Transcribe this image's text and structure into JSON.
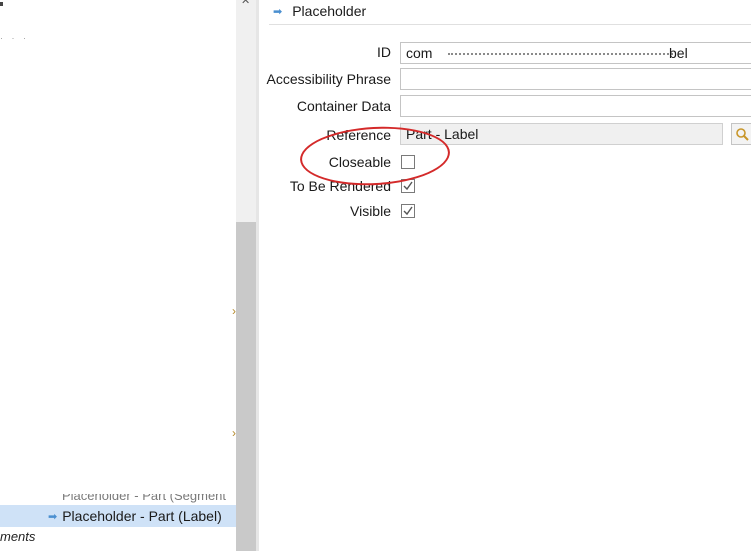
{
  "tree": {
    "partial_row": "Placeholder - Part (Segment",
    "partial_row_bracket": "t",
    "selected_row": "Placeholder - Part (Label)",
    "bottom_row": "ments"
  },
  "properties": {
    "section_title": "Placeholder",
    "fields": {
      "id": {
        "label": "ID",
        "value_start": "com",
        "value_end": "bel"
      },
      "accessibility": {
        "label": "Accessibility Phrase",
        "value": ""
      },
      "container_data": {
        "label": "Container Data",
        "value": ""
      },
      "reference": {
        "label": "Reference",
        "value": "Part - Label"
      }
    },
    "checkboxes": {
      "closeable": {
        "label": "Closeable",
        "checked": false
      },
      "to_be_rendered": {
        "label": "To Be Rendered",
        "checked": true
      },
      "visible": {
        "label": "Visible",
        "checked": true
      }
    }
  },
  "icons": {
    "section_arrow": "arrow-right-icon",
    "tree_arrow": "arrow-right-icon",
    "reference_search": "search-icon"
  },
  "colors": {
    "selection": "#cfe2f7",
    "annotation": "#d42a2a",
    "arrow": "#4a8fd0"
  }
}
